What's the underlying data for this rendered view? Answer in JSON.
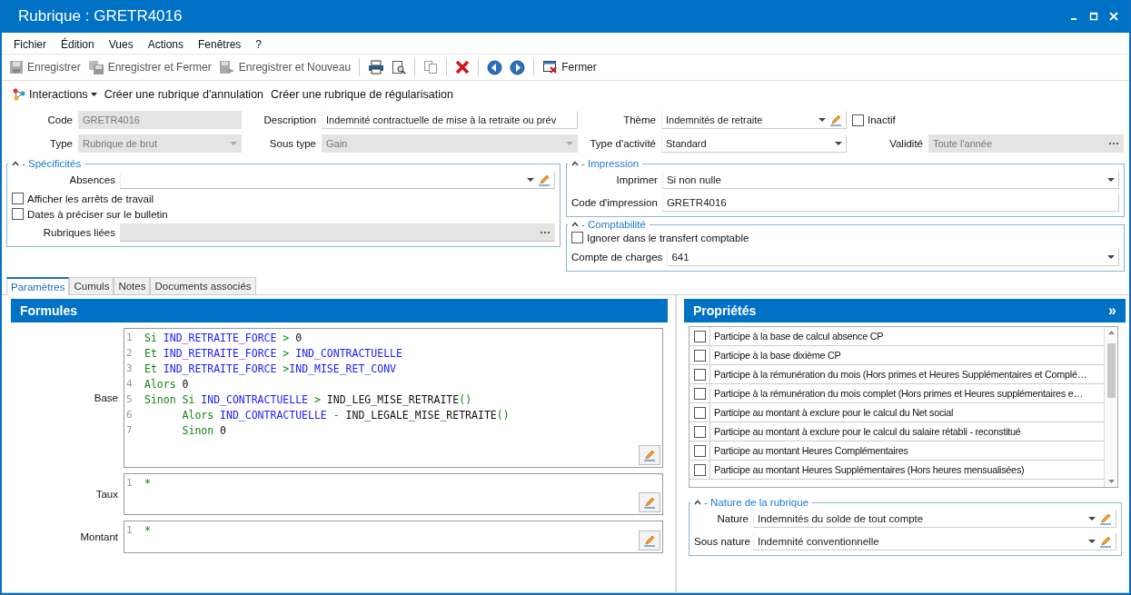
{
  "window": {
    "title": "Rubrique : GRETR4016"
  },
  "menu": [
    "Fichier",
    "Édition",
    "Vues",
    "Actions",
    "Fenêtres",
    "?"
  ],
  "toolbar": [
    {
      "kind": "save",
      "label": "Enregistrer",
      "disabled": true
    },
    {
      "kind": "save-close",
      "label": "Enregistrer et Fermer",
      "disabled": true
    },
    {
      "kind": "save-new",
      "label": "Enregistrer et Nouveau",
      "disabled": true
    },
    {
      "kind": "separator"
    },
    {
      "kind": "print"
    },
    {
      "kind": "preview"
    },
    {
      "kind": "separator"
    },
    {
      "kind": "copy"
    },
    {
      "kind": "separator"
    },
    {
      "kind": "delete"
    },
    {
      "kind": "separator"
    },
    {
      "kind": "back"
    },
    {
      "kind": "forward"
    },
    {
      "kind": "separator"
    },
    {
      "kind": "close",
      "label": "Fermer",
      "disabled": false
    }
  ],
  "actions": [
    {
      "kind": "dropdown",
      "label": "Interactions"
    },
    {
      "kind": "link",
      "label": "Créer une rubrique d'annulation"
    },
    {
      "kind": "link",
      "label": "Créer une rubrique de régularisation"
    }
  ],
  "header_fields": [
    {
      "kind": "text",
      "label": "Code",
      "value": "GRETR4016",
      "disabled": true
    },
    {
      "kind": "text",
      "label": "Description",
      "value": "Indemnité contractuelle de mise à la retraite ou prév",
      "disabled": false
    },
    {
      "kind": "combo-edit",
      "label": "Thème",
      "value": "Indemnités de retraite",
      "disabled": false
    },
    {
      "kind": "checkbox",
      "label": "Inactif",
      "checked": false
    },
    {
      "kind": "combo",
      "label": "Type",
      "value": "Rubrique de brut",
      "disabled": true
    },
    {
      "kind": "combo",
      "label": "Sous type",
      "value": "Gain",
      "disabled": true
    },
    {
      "kind": "combo",
      "label": "Type d'activité",
      "value": "Standard",
      "disabled": false
    },
    {
      "kind": "ellipsis",
      "label": "Validité",
      "value": "Toute l'année",
      "disabled": true
    }
  ],
  "specificites": {
    "title": "- Spécificités",
    "expanded": true,
    "fields": [
      {
        "kind": "combo-edit",
        "label": "Absences",
        "disabled": false
      },
      {
        "kind": "checkbox",
        "label": "Afficher les arrêts de travail",
        "checked": false
      },
      {
        "kind": "checkbox",
        "label": "Dates à préciser sur le bulletin",
        "checked": false
      },
      {
        "kind": "ellipsis",
        "label": "Rubriques liées",
        "disabled": true
      }
    ]
  },
  "impression": {
    "title": "- Impression",
    "expanded": true,
    "fields": [
      {
        "kind": "combo",
        "label": "Imprimer",
        "value": "Si non nulle",
        "disabled": false
      },
      {
        "kind": "text",
        "label": "Code d'impression",
        "value": "GRETR4016",
        "disabled": false
      }
    ]
  },
  "comptabilite": {
    "title": "- Comptabilité",
    "expanded": true,
    "fields": [
      {
        "kind": "checkbox",
        "label": "Ignorer dans le transfert comptable",
        "checked": false
      },
      {
        "kind": "combo",
        "label": "Compte de charges",
        "value": "641",
        "disabled": false
      }
    ]
  },
  "tabs": [
    {
      "label": "Paramètres",
      "selected": true
    },
    {
      "label": "Cumuls",
      "selected": false
    },
    {
      "label": "Notes",
      "selected": false
    },
    {
      "label": "Documents associés",
      "selected": false
    }
  ],
  "formules": {
    "title": "Formules",
    "editors": [
      {
        "label": "Base",
        "lines": [
          {
            "number": "1",
            "indented": false,
            "tokens": [
              {
                "kind": "keyword",
                "t": "Si "
              },
              {
                "kind": "variable",
                "t": "IND_RETRAITE_FORCE "
              },
              {
                "kind": "operator",
                "t": "> "
              },
              {
                "kind": "plain",
                "t": "0"
              }
            ]
          },
          {
            "number": "2",
            "indented": false,
            "tokens": [
              {
                "kind": "keyword",
                "t": "Et "
              },
              {
                "kind": "variable",
                "t": "IND_RETRAITE_FORCE "
              },
              {
                "kind": "operator",
                "t": "> "
              },
              {
                "kind": "variable",
                "t": "IND_CONTRACTUELLE"
              }
            ]
          },
          {
            "number": "3",
            "indented": false,
            "tokens": [
              {
                "kind": "keyword",
                "t": "Et "
              },
              {
                "kind": "variable",
                "t": "IND_RETRAITE_FORCE "
              },
              {
                "kind": "operator",
                "t": ">"
              },
              {
                "kind": "variable",
                "t": "IND_MISE_RET_CONV"
              }
            ]
          },
          {
            "number": "4",
            "indented": false,
            "tokens": [
              {
                "kind": "keyword",
                "t": "Alors "
              },
              {
                "kind": "plain",
                "t": "0"
              }
            ]
          },
          {
            "number": "5",
            "indented": false,
            "tokens": [
              {
                "kind": "keyword",
                "t": "Sinon Si "
              },
              {
                "kind": "variable",
                "t": "IND_CONTRACTUELLE "
              },
              {
                "kind": "operator",
                "t": "> "
              },
              {
                "kind": "plain",
                "t": "IND_LEG_MISE_RETRAITE"
              },
              {
                "kind": "operator",
                "t": "()"
              }
            ]
          },
          {
            "number": "6",
            "indented": true,
            "tokens": [
              {
                "kind": "keyword",
                "t": "Alors "
              },
              {
                "kind": "variable",
                "t": "IND_CONTRACTUELLE "
              },
              {
                "kind": "operator",
                "t": "- "
              },
              {
                "kind": "plain",
                "t": "IND_LEGALE_MISE_RETRAITE"
              },
              {
                "kind": "operator",
                "t": "()"
              }
            ]
          },
          {
            "number": "7",
            "indented": true,
            "tokens": [
              {
                "kind": "keyword",
                "t": "Sinon "
              },
              {
                "kind": "plain",
                "t": "0"
              }
            ]
          }
        ]
      },
      {
        "label": "Taux",
        "lines": [
          {
            "number": "1",
            "indented": false,
            "tokens": [
              {
                "kind": "keyword",
                "t": "*"
              }
            ]
          }
        ]
      },
      {
        "label": "Montant",
        "lines": [
          {
            "number": "1",
            "indented": false,
            "tokens": [
              {
                "kind": "keyword",
                "t": "*"
              }
            ]
          }
        ]
      }
    ]
  },
  "proprietes": {
    "title": "Propriétés",
    "expand_glyph": "»",
    "items": [
      {
        "label": "Participe à la base de calcul absence CP",
        "checked": false
      },
      {
        "label": "Participe à la base dixième CP",
        "checked": false
      },
      {
        "label": "Participe à la rémunération du mois (Hors primes et Heures Supplémentaires et Complé…",
        "checked": false
      },
      {
        "label": "Participe à la rémunération du mois complet (Hors primes et Heures supplémentaires e…",
        "checked": false
      },
      {
        "label": "Participe au montant à exclure pour le calcul du Net social",
        "checked": false
      },
      {
        "label": "Participe au montant à exclure pour le calcul du salaire rétabli - reconstitué",
        "checked": false
      },
      {
        "label": "Participe au montant Heures Complémentaires",
        "checked": false
      },
      {
        "label": "Participe au montant Heures Supplémentaires (Hors heures mensualisées)",
        "checked": false
      }
    ]
  },
  "nature": {
    "title": "- Nature de la rubrique",
    "expanded": true,
    "fields": [
      {
        "kind": "combo-edit",
        "label": "Nature",
        "value": "Indemnités du solde de tout compte",
        "disabled": false
      },
      {
        "kind": "combo-edit",
        "label": "Sous nature",
        "value": "Indemnité conventionnelle",
        "disabled": false
      }
    ]
  }
}
